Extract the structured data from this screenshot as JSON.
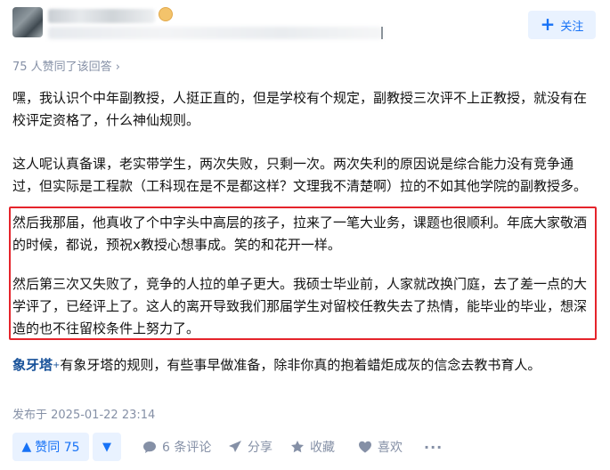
{
  "author": {
    "avatar_icon": "avatar",
    "badge_icon": "badge-icon"
  },
  "follow_button": {
    "label": "关注",
    "icon": "plus-icon"
  },
  "likes_summary": "75 人赞同了该回答 ›",
  "answer": {
    "paragraphs": [
      "嘿，我认识个中年副教授，人挺正直的，但是学校有个规定，副教授三次评不上正教授，就没有在校评定资格了，什么神仙规则。",
      "这人呢认真备课，老实带学生，两次失败，只剩一次。两次失利的原因说是综合能力没有竞争通过，但实际是工程款（工科现在是不是都这样？文理我不清楚啊）拉的不如其他学院的副教授多。",
      "然后我那届，他真收了个中字头中高层的孩子，拉来了一笔大业务，课题也很顺利。年底大家敬酒的时候，都说，预祝x教授心想事成。笑的和花开一样。",
      "然后第三次又失败了，竞争的人拉的单子更大。我硕士毕业前，人家就改换门庭，去了差一点的大学评了，已经评上了。这人的离开导致我们那届学生对留校任教失去了热情，能毕业的毕业，想深造的也不往留校条件上努力了。"
    ],
    "signature_name": "象牙塔",
    "signature_mark": "+",
    "signature_text": "有象牙塔的规则，有些事早做准备，除非你真的抱着蜡炬成灰的信念去教书育人。"
  },
  "published": "发布于 2025-01-22 23:14",
  "actions": {
    "upvote_label": "赞同 75",
    "downvote_icon": "triangle-down-icon",
    "comments_label": "6 条评论",
    "share_label": "分享",
    "favorite_label": "收藏",
    "like_label": "喜欢",
    "more_icon": "more-icon"
  },
  "colors": {
    "accent": "#1772f6",
    "accent_bg": "#e9f2ff",
    "muted": "#8590a6",
    "highlight_border": "#e5242b",
    "signature": "#175199"
  }
}
